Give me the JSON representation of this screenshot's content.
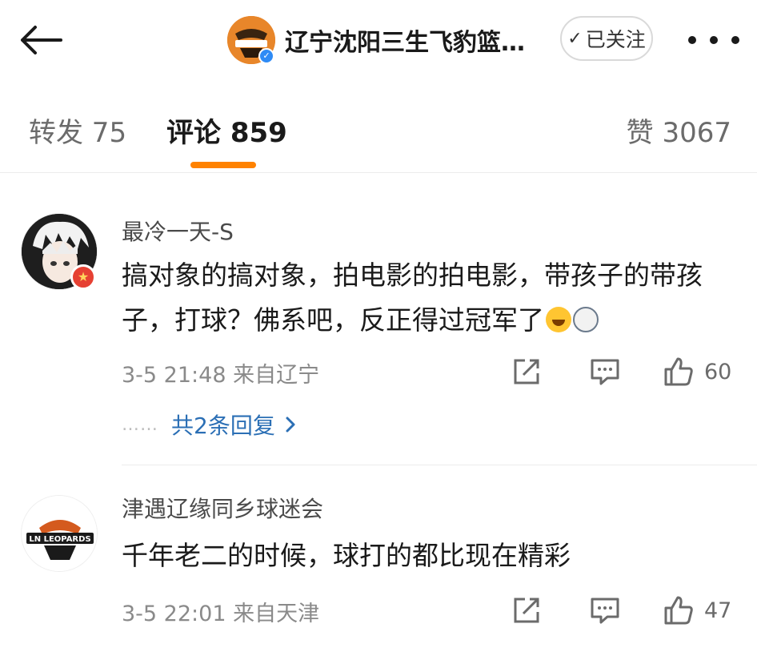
{
  "header": {
    "back_icon": "arrow-left-icon",
    "account_name": "辽宁沈阳三生飞豹篮…",
    "follow_label": "已关注",
    "more_icon": "more-dots-icon",
    "verify_icon": "verified-icon"
  },
  "tabs": [
    {
      "label": "转发 75",
      "active": false
    },
    {
      "label": "评论 859",
      "active": true
    },
    {
      "label": "赞 3067",
      "active": false
    }
  ],
  "colors": {
    "accent": "#ff8200",
    "link": "#2b6fb5",
    "verify": "#2f8bf5"
  },
  "comments": [
    {
      "username": "最冷一天-S",
      "text": "搞对象的搞对象，拍电影的拍电影，带孩子的带孩子，打球？佛系吧，反正得过冠军了",
      "emojis": [
        "laughing-crying-emoji",
        "surprised-dog-emoji"
      ],
      "meta": "3-5 21:48 来自辽宁",
      "likes": "60",
      "replies": {
        "dots": "……",
        "label": "共2条回复"
      }
    },
    {
      "username": "津遇辽缘同乡球迷会",
      "text": "千年老二的时候，球打的都比现在精彩",
      "meta": "3-5 22:01 来自天津",
      "likes": "47",
      "avatar_logo_text": "LN LEOPARDS"
    }
  ]
}
